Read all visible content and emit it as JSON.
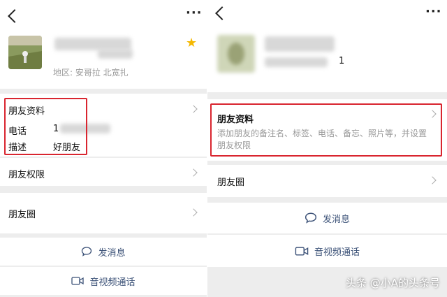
{
  "left": {
    "region": "地区: 安哥拉  北宽扎",
    "profile_section_title": "朋友资料",
    "phone_label": "电话",
    "phone_value": "1",
    "desc_label": "描述",
    "desc_value": "好朋友",
    "permissions_label": "朋友权限",
    "moments_label": "朋友圈",
    "message_label": "发消息",
    "call_label": "音视频通话"
  },
  "right": {
    "name_suffix": "1",
    "profile_section_title": "朋友资料",
    "profile_hint": "添加朋友的备注名、标签、电话、备忘、照片等，并设置朋友权限",
    "moments_label": "朋友圈",
    "message_label": "发消息",
    "call_label": "音视频通话"
  },
  "watermark": "头条 @小A的头条号",
  "colors": {
    "highlight": "#d9252f",
    "link": "#3b5177",
    "star": "#f5b800"
  },
  "icons": [
    "back-arrow-icon",
    "more-icon",
    "star-icon",
    "chevron-right-icon",
    "chat-bubble-icon",
    "video-camera-icon"
  ]
}
